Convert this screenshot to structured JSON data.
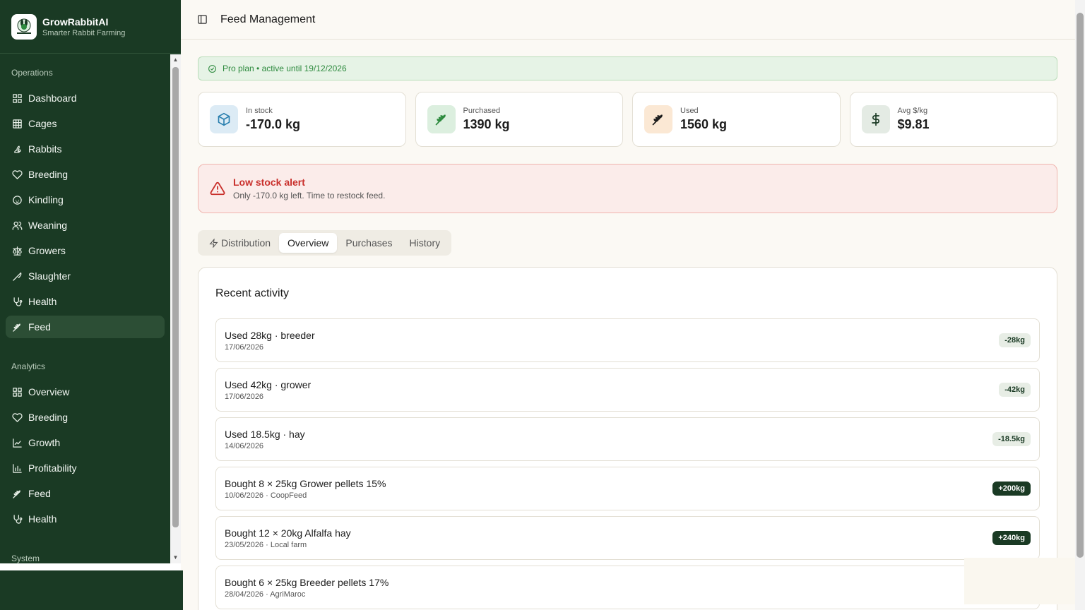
{
  "brand": {
    "name": "GrowRabbitAI",
    "tagline": "Smarter Rabbit Farming",
    "logo_text": "GrowRabbitAI"
  },
  "header": {
    "title": "Feed Management"
  },
  "sidebar": {
    "sections": [
      {
        "label": "Operations",
        "items": [
          {
            "label": "Dashboard",
            "icon": "grid-icon"
          },
          {
            "label": "Cages",
            "icon": "table-icon"
          },
          {
            "label": "Rabbits",
            "icon": "rabbit-icon"
          },
          {
            "label": "Breeding",
            "icon": "heart-icon"
          },
          {
            "label": "Kindling",
            "icon": "baby-icon"
          },
          {
            "label": "Weaning",
            "icon": "users-icon"
          },
          {
            "label": "Growers",
            "icon": "scale-icon"
          },
          {
            "label": "Slaughter",
            "icon": "knife-icon"
          },
          {
            "label": "Health",
            "icon": "stethoscope-icon"
          },
          {
            "label": "Feed",
            "icon": "wheat-icon",
            "active": true
          }
        ]
      },
      {
        "label": "Analytics",
        "items": [
          {
            "label": "Overview",
            "icon": "grid-icon"
          },
          {
            "label": "Breeding",
            "icon": "heart-icon"
          },
          {
            "label": "Growth",
            "icon": "line-chart-icon"
          },
          {
            "label": "Profitability",
            "icon": "bar-chart-icon"
          },
          {
            "label": "Feed",
            "icon": "wheat-icon"
          },
          {
            "label": "Health",
            "icon": "stethoscope-icon"
          }
        ]
      },
      {
        "label": "System",
        "items": []
      }
    ]
  },
  "plan": {
    "text": "Pro plan • active until 19/12/2026"
  },
  "stats": [
    {
      "label": "In stock",
      "value": "-170.0 kg",
      "icon": "package-icon",
      "bg": "#dcebf5",
      "color": "#2a7fae"
    },
    {
      "label": "Purchased",
      "value": "1390 kg",
      "icon": "wheat-icon",
      "bg": "#dcefdf",
      "color": "#2d8a3e"
    },
    {
      "label": "Used",
      "value": "1560 kg",
      "icon": "wheat-icon",
      "bg": "#fbe8d4",
      "color": "#1c1c1c"
    },
    {
      "label": "Avg $/kg",
      "value": "$9.81",
      "icon": "dollar-icon",
      "bg": "#e4ebe4",
      "color": "#1a3a24"
    }
  ],
  "alert": {
    "title": "Low stock alert",
    "message": "Only -170.0 kg left. Time to restock feed."
  },
  "tabs": [
    {
      "label": "Distribution",
      "icon": "zap-icon"
    },
    {
      "label": "Overview",
      "active": true
    },
    {
      "label": "Purchases"
    },
    {
      "label": "History"
    }
  ],
  "activity": {
    "title": "Recent activity",
    "items": [
      {
        "main": "Used 28kg · breeder",
        "sub": "17/06/2026",
        "badge": "-28kg",
        "type": "neg"
      },
      {
        "main": "Used 42kg · grower",
        "sub": "17/06/2026",
        "badge": "-42kg",
        "type": "neg"
      },
      {
        "main": "Used 18.5kg · hay",
        "sub": "14/06/2026",
        "badge": "-18.5kg",
        "type": "neg"
      },
      {
        "main": "Bought 8 × 25kg Grower pellets 15%",
        "sub": "10/06/2026 · CoopFeed",
        "badge": "+200kg",
        "type": "pos"
      },
      {
        "main": "Bought 12 × 20kg Alfalfa hay",
        "sub": "23/05/2026 · Local farm",
        "badge": "+240kg",
        "type": "pos"
      },
      {
        "main": "Bought 6 × 25kg Breeder pellets 17%",
        "sub": "28/04/2026 · AgriMaroc",
        "badge": "",
        "type": "pos"
      }
    ]
  },
  "colors": {
    "sidebar": "#1a3a24",
    "accent": "#2d8a3e",
    "danger": "#c9302c",
    "background": "#fbf9f4"
  }
}
